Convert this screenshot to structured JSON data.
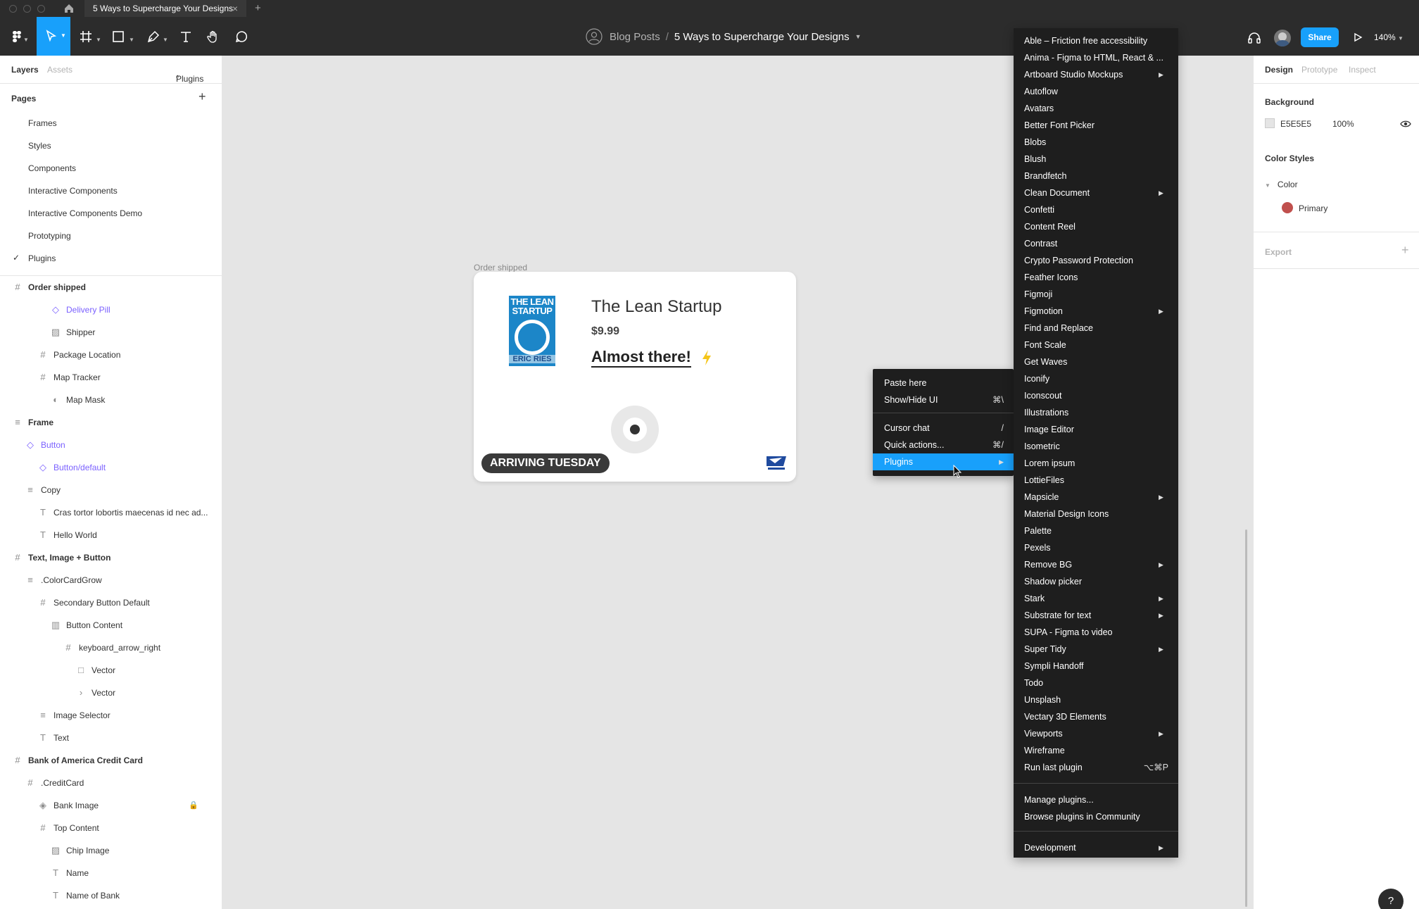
{
  "tab": {
    "title": "5 Ways to Supercharge Your Designs"
  },
  "toolbar": {
    "team": "Blog Posts",
    "separator": "/",
    "file": "5 Ways to Supercharge Your Designs",
    "share_label": "Share",
    "zoom": "140%"
  },
  "left_panel": {
    "tabs": [
      "Layers",
      "Assets"
    ],
    "plugins_label": "Plugins",
    "pages_title": "Pages",
    "pages": [
      "Frames",
      "Styles",
      "Components",
      "Interactive Components",
      "Interactive Components Demo",
      "Prototyping",
      "Plugins"
    ],
    "current_page": "Plugins",
    "layers": [
      {
        "label": "Order shipped",
        "icon": "#",
        "depth": 0,
        "bold": true
      },
      {
        "label": "Delivery Pill",
        "icon": "◇",
        "depth": 3,
        "component": true
      },
      {
        "label": "Shipper",
        "icon": "▨",
        "depth": 3
      },
      {
        "label": "Package Location",
        "icon": "#",
        "depth": 2
      },
      {
        "label": "Map Tracker",
        "icon": "#",
        "depth": 2
      },
      {
        "label": "Map Mask",
        "icon": "◐",
        "depth": 3
      },
      {
        "label": "Frame",
        "icon": "≡",
        "depth": 0,
        "bold": true
      },
      {
        "label": "Button",
        "icon": "◇",
        "depth": 1,
        "component": true
      },
      {
        "label": "Button/default",
        "icon": "◇",
        "depth": 2,
        "component": true
      },
      {
        "label": "Copy",
        "icon": "≡",
        "depth": 1
      },
      {
        "label": "Cras tortor lobortis maecenas id nec ad...",
        "icon": "T",
        "depth": 2
      },
      {
        "label": "Hello World",
        "icon": "T",
        "depth": 2
      },
      {
        "label": "Text, Image + Button",
        "icon": "#",
        "depth": 0,
        "bold": true
      },
      {
        "label": ".ColorCardGrow",
        "icon": "≡",
        "depth": 1
      },
      {
        "label": "Secondary Button Default",
        "icon": "#",
        "depth": 2
      },
      {
        "label": "Button Content",
        "icon": "▥",
        "depth": 3
      },
      {
        "label": "keyboard_arrow_right",
        "icon": "#",
        "depth": 4
      },
      {
        "label": "Vector",
        "icon": "□",
        "depth": 5
      },
      {
        "label": "Vector",
        "icon": "›",
        "depth": 5
      },
      {
        "label": "Image Selector",
        "icon": "≡",
        "depth": 2
      },
      {
        "label": "Text",
        "icon": "T",
        "depth": 2
      },
      {
        "label": "Bank of America Credit Card",
        "icon": "#",
        "depth": 0,
        "bold": true
      },
      {
        "label": ".CreditCard",
        "icon": "#",
        "depth": 1
      },
      {
        "label": "Bank Image",
        "icon": "◈",
        "depth": 2,
        "locked": true
      },
      {
        "label": "Top Content",
        "icon": "#",
        "depth": 2
      },
      {
        "label": "Chip Image",
        "icon": "▨",
        "depth": 3
      },
      {
        "label": "Name",
        "icon": "T",
        "depth": 3
      },
      {
        "label": "Name of Bank",
        "icon": "T",
        "depth": 3
      }
    ]
  },
  "canvas": {
    "frame_label": "Order shipped",
    "card": {
      "book_title_line1": "THE LEAN",
      "book_title_line2": "STARTUP",
      "book_author": "ERIC RIES",
      "title": "The Lean Startup",
      "price": "$9.99",
      "status": "Almost there!",
      "pill": "ARRIVING TUESDAY"
    }
  },
  "context_menu": {
    "items": [
      {
        "label": "Paste here",
        "shortcut": ""
      },
      {
        "label": "Show/Hide UI",
        "shortcut": "⌘\\"
      },
      {
        "label": "Cursor chat",
        "shortcut": "/"
      },
      {
        "label": "Quick actions...",
        "shortcut": "⌘/"
      },
      {
        "label": "Plugins",
        "shortcut": "▶"
      }
    ]
  },
  "plugins_menu": {
    "items": [
      {
        "label": "Able – Friction free accessibility"
      },
      {
        "label": "Anima - Figma to HTML, React & ..."
      },
      {
        "label": "Artboard Studio Mockups",
        "sub": true
      },
      {
        "label": "Autoflow"
      },
      {
        "label": "Avatars"
      },
      {
        "label": "Better Font Picker"
      },
      {
        "label": "Blobs"
      },
      {
        "label": "Blush"
      },
      {
        "label": "Brandfetch"
      },
      {
        "label": "Clean Document",
        "sub": true
      },
      {
        "label": "Confetti"
      },
      {
        "label": "Content Reel"
      },
      {
        "label": "Contrast"
      },
      {
        "label": "Crypto Password Protection"
      },
      {
        "label": "Feather Icons"
      },
      {
        "label": "Figmoji"
      },
      {
        "label": "Figmotion",
        "sub": true
      },
      {
        "label": "Find and Replace"
      },
      {
        "label": "Font Scale"
      },
      {
        "label": "Get Waves"
      },
      {
        "label": "Iconify"
      },
      {
        "label": "Iconscout"
      },
      {
        "label": "Illustrations"
      },
      {
        "label": "Image Editor"
      },
      {
        "label": "Isometric"
      },
      {
        "label": "Lorem ipsum"
      },
      {
        "label": "LottieFiles"
      },
      {
        "label": "Mapsicle",
        "sub": true
      },
      {
        "label": "Material Design Icons"
      },
      {
        "label": "Palette"
      },
      {
        "label": "Pexels"
      },
      {
        "label": "Remove BG",
        "sub": true
      },
      {
        "label": "Shadow picker"
      },
      {
        "label": "Stark",
        "sub": true
      },
      {
        "label": "Substrate for text",
        "sub": true
      },
      {
        "label": "SUPA - Figma to video"
      },
      {
        "label": "Super Tidy",
        "sub": true
      },
      {
        "label": "Sympli Handoff"
      },
      {
        "label": "Todo"
      },
      {
        "label": "Unsplash"
      },
      {
        "label": "Vectary 3D Elements"
      },
      {
        "label": "Viewports",
        "sub": true
      },
      {
        "label": "Wireframe"
      },
      {
        "label": "Run last plugin",
        "shortcut": "⌥⌘P"
      }
    ],
    "manage": "Manage plugins...",
    "browse": "Browse plugins in Community",
    "development": "Development"
  },
  "right_panel": {
    "tabs": [
      "Design",
      "Prototype",
      "Inspect"
    ],
    "background_title": "Background",
    "background_hex": "E5E5E5",
    "background_opacity": "100%",
    "color_styles_title": "Color Styles",
    "color_group": "Color",
    "primary_label": "Primary",
    "export_title": "Export"
  },
  "help_label": "?",
  "colors": {
    "accent": "#18a0fb",
    "toolbar": "#2c2c2c",
    "canvas": "#e5e5e5",
    "component": "#7b61ff",
    "primary_swatch": "#c0504d"
  }
}
